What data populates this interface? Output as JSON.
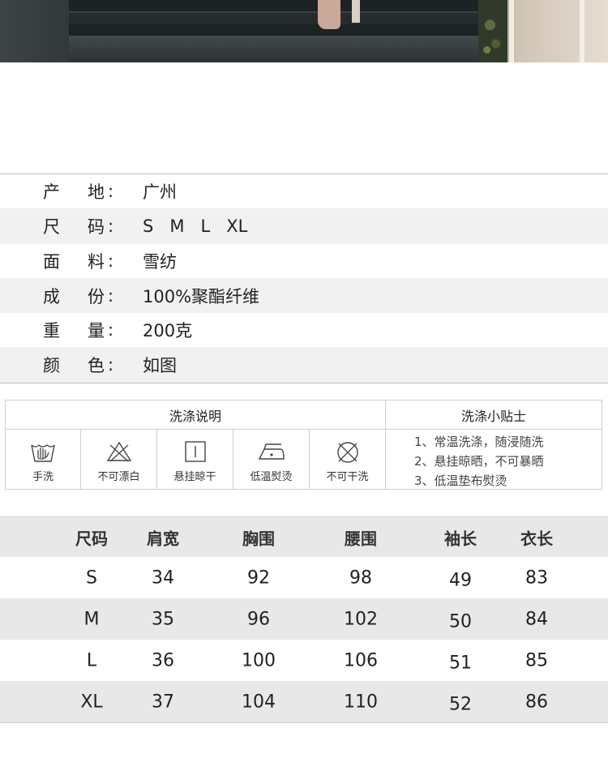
{
  "info": [
    {
      "k1": "产",
      "k2": "地",
      "colon": ":",
      "value": "广州"
    },
    {
      "k1": "尺",
      "k2": "码",
      "colon": ":",
      "value": "S   M   L   XL"
    },
    {
      "k1": "面",
      "k2": "料",
      "colon": ":",
      "value": "雪纺"
    },
    {
      "k1": "成",
      "k2": "份",
      "colon": ":",
      "value": "100%聚酯纤维"
    },
    {
      "k1": "重",
      "k2": "量",
      "colon": ":",
      "value": "200克"
    },
    {
      "k1": "颜",
      "k2": "色",
      "colon": ":",
      "value": "如图"
    }
  ],
  "care": {
    "left_header": "洗涤说明",
    "right_header": "洗涤小贴士",
    "icons": [
      {
        "icon": "hand-wash-icon",
        "label": "手洗"
      },
      {
        "icon": "no-bleach-icon",
        "label": "不可漂白"
      },
      {
        "icon": "hang-dry-icon",
        "label": "悬挂晾干"
      },
      {
        "icon": "low-iron-icon",
        "label": "低温熨烫"
      },
      {
        "icon": "no-dry-clean-icon",
        "label": "不可干洗"
      }
    ],
    "tips": [
      "1、常温洗涤，随浸随洗",
      "2、悬挂晾晒，不可暴晒",
      "3、低温垫布熨烫"
    ]
  },
  "size_table": {
    "headers": [
      "尺码",
      "肩宽",
      "胸围",
      "腰围",
      "袖长",
      "衣长"
    ],
    "rows": [
      [
        "S",
        "34",
        "92",
        "98",
        "49",
        "83"
      ],
      [
        "M",
        "35",
        "96",
        "102",
        "50",
        "84"
      ],
      [
        "L",
        "36",
        "100",
        "106",
        "51",
        "85"
      ],
      [
        "XL",
        "37",
        "104",
        "110",
        "52",
        "86"
      ]
    ]
  }
}
